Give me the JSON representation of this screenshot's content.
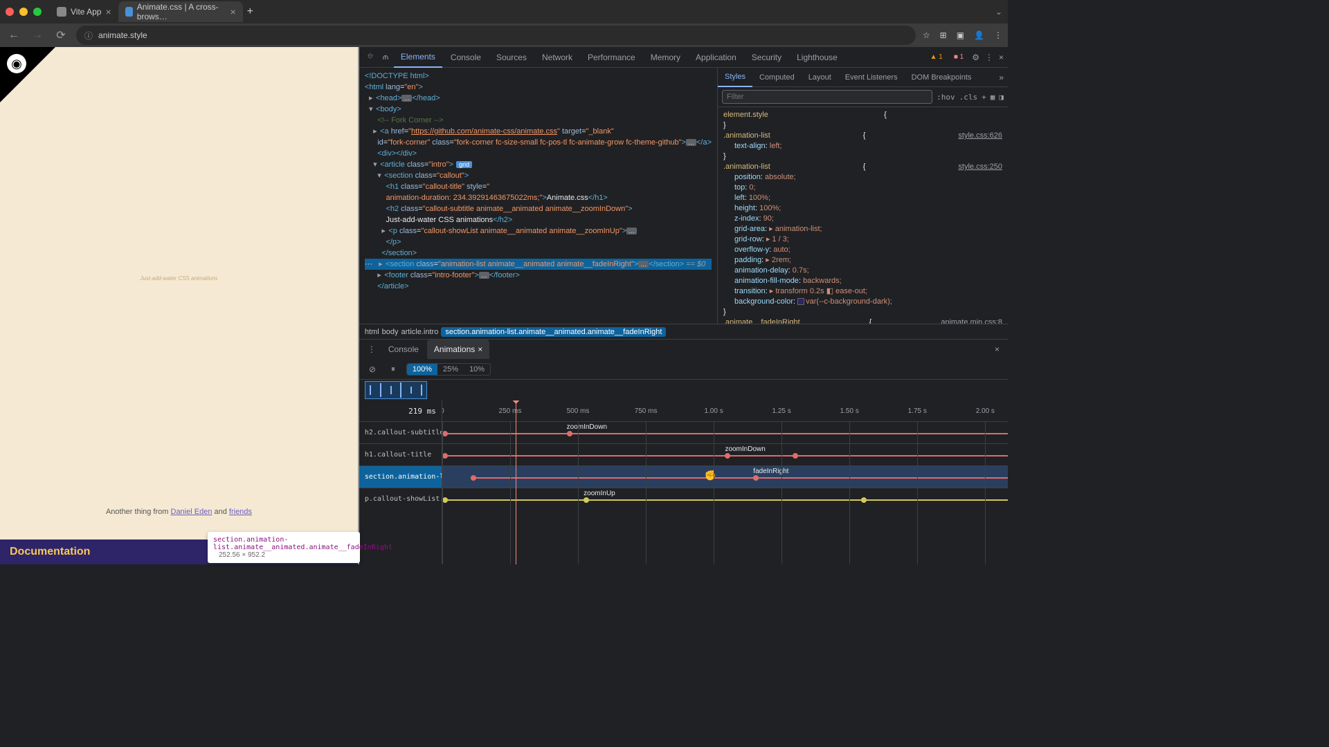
{
  "browser": {
    "tabs": [
      {
        "title": "Vite App",
        "active": false
      },
      {
        "title": "Animate.css | A cross-brows…",
        "active": true
      }
    ],
    "url": "animate.style",
    "nav": {
      "back": "←",
      "fwd": "→",
      "reload": "⟳"
    }
  },
  "page": {
    "subtitle": "Just-add-water CSS animations",
    "footer_prefix": "Another thing from ",
    "footer_author": "Daniel Eden",
    "footer_and": " and ",
    "footer_friends": "friends",
    "doc_label": "Documentation",
    "tooltip_selector": "section.animation-list.animate__animated.animate__fadeInRight",
    "tooltip_dims": "252.56 × 952.2"
  },
  "devtools": {
    "tabs": [
      "Elements",
      "Console",
      "Sources",
      "Network",
      "Performance",
      "Memory",
      "Application",
      "Security",
      "Lighthouse"
    ],
    "active_tab": "Elements",
    "warn_count": "1",
    "issue_count": "1",
    "breadcrumbs": [
      "html",
      "body",
      "article.intro",
      "section.animation-list.animate__animated.animate__fadeInRight"
    ],
    "dom": {
      "doctype": "<!DOCTYPE html>",
      "html_open": "<html lang=\"en\">",
      "head": "<head>…</head>",
      "body_open": "<body>",
      "comment": "<!-- Fork Corner -->",
      "a_href": "https://github.com/animate-css/animate.css",
      "a_target": "_blank",
      "a_id": "fork-corner",
      "a_class": "fork-corner fc-size-small fc-pos-tl fc-animate-grow fc-theme-github",
      "divdiv": "<div></div>",
      "article_class": "intro",
      "section_callout": "callout",
      "h1_class": "callout-title",
      "h1_style": "animation-duration: 234.39291463675022ms;",
      "h1_text": "Animate.css",
      "h2_class": "callout-subtitle animate__animated animate__zoomInDown",
      "h2_text": "Just-add-water CSS animations",
      "p_class": "callout-showList animate__animated animate__zoomInUp",
      "section_anim_class": "animation-list animate__animated animate__fadeInRight",
      "footer_class": "intro-footer",
      "dollar0": "== $0"
    },
    "styles": {
      "tabs": [
        "Styles",
        "Computed",
        "Layout",
        "Event Listeners",
        "DOM Breakpoints"
      ],
      "active_tab": "Styles",
      "filter_placeholder": "Filter",
      "hov": ":hov",
      "cls": ".cls",
      "rules": [
        {
          "selector": "element.style",
          "source": "",
          "props": []
        },
        {
          "selector": ".animation-list",
          "source": "style.css:626",
          "props": [
            {
              "name": "text-align",
              "value": "left;"
            }
          ]
        },
        {
          "selector": ".animation-list",
          "source": "style.css:250",
          "props": [
            {
              "name": "position",
              "value": "absolute;"
            },
            {
              "name": "top",
              "value": "0;"
            },
            {
              "name": "left",
              "value": "100%;"
            },
            {
              "name": "height",
              "value": "100%;"
            },
            {
              "name": "z-index",
              "value": "90;"
            },
            {
              "name": "grid-area",
              "value": "▸ animation-list;"
            },
            {
              "name": "grid-row",
              "value": "▸ 1 / 3;"
            },
            {
              "name": "overflow-y",
              "value": "auto;"
            },
            {
              "name": "padding",
              "value": "▸ 2rem;"
            },
            {
              "name": "animation-delay",
              "value": "0.7s;"
            },
            {
              "name": "animation-fill-mode",
              "value": "backwards;"
            },
            {
              "name": "transition",
              "value": "▸ transform 0.2s ◧ ease-out;"
            },
            {
              "name": "background-color",
              "value": "var(--c-background-dark);",
              "swatch": "#2e2468"
            }
          ]
        },
        {
          "selector": ".animate__fadeInRight",
          "source": "animate.min.css:8",
          "props": []
        }
      ]
    }
  },
  "drawer": {
    "tabs": [
      "Console",
      "Animations"
    ],
    "active_tab": "Animations",
    "speeds": [
      "100%",
      "25%",
      "10%"
    ],
    "active_speed": "100%",
    "time_label": "219 ms",
    "ruler": [
      "0",
      "250 ms",
      "500 ms",
      "750 ms",
      "1.00 s",
      "1.25 s",
      "1.50 s",
      "1.75 s",
      "2.00 s"
    ],
    "tracks": [
      {
        "element": "h2.callout-subtitle",
        "name": "zoomInDown",
        "color": "red",
        "start": 0,
        "key1": 22,
        "end": 100
      },
      {
        "element": "h1.callout-title",
        "name": "zoomInDown",
        "color": "red",
        "start": 0,
        "key1": 50,
        "key2": 62,
        "end": 100
      },
      {
        "element": "section.animation-l",
        "name": "fadeInRight",
        "color": "red",
        "start": 5,
        "key1": 55,
        "end": 100,
        "selected": true
      },
      {
        "element": "p.callout-showList.",
        "name": "zoomInUp",
        "color": "yellow",
        "start": 0,
        "key1": 25,
        "key2": 74,
        "end": 100
      }
    ],
    "playhead_pct": 13
  }
}
